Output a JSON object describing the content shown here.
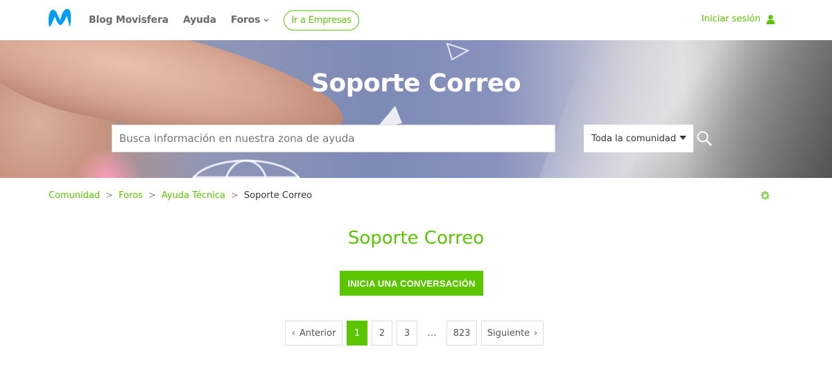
{
  "header": {
    "nav": [
      {
        "label": "Blog Movisfera"
      },
      {
        "label": "Ayuda"
      },
      {
        "label": "Foros"
      }
    ],
    "empresas_label": "Ir a Empresas",
    "login_label": "Iniciar sesión"
  },
  "hero": {
    "title": "Soporte Correo",
    "search_placeholder": "Busca información en nuestra zona de ayuda",
    "scope_value": "Toda la comunidad"
  },
  "breadcrumb": {
    "items": [
      "Comunidad",
      "Foros",
      "Ayuda Técnica"
    ],
    "current": "Soporte Correo",
    "separator": ">"
  },
  "main": {
    "title": "Soporte Correo",
    "cta_label": "INICIA UNA CONVERSACIÓN"
  },
  "pagination": {
    "prev_label": "Anterior",
    "pages": [
      "1",
      "2",
      "3"
    ],
    "ellipsis": "…",
    "last": "823",
    "next_label": "Siguiente",
    "current": "1"
  },
  "colors": {
    "brand_green": "#5bc500",
    "logo_blue": "#019df4"
  }
}
